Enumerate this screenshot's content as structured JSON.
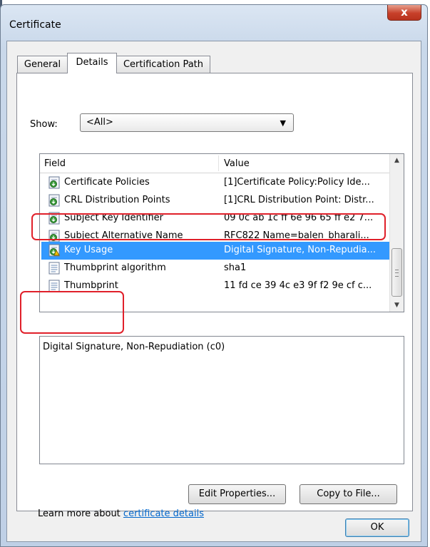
{
  "window": {
    "title": "Certificate",
    "close_symbol": "x"
  },
  "tabs": [
    {
      "label": "General",
      "active": false
    },
    {
      "label": "Details",
      "active": true
    },
    {
      "label": "Certification Path",
      "active": false
    }
  ],
  "show": {
    "label": "Show:",
    "selected": "<All>"
  },
  "table": {
    "headers": {
      "field": "Field",
      "value": "Value"
    },
    "rows": [
      {
        "field": "Certificate Policies",
        "value": "[1]Certificate Policy:Policy Ide...",
        "icon": "certificate-extension-icon"
      },
      {
        "field": "CRL Distribution Points",
        "value": "[1]CRL Distribution Point: Distr...",
        "icon": "certificate-extension-icon"
      },
      {
        "field": "Subject Key Identifier",
        "value": "09 0c ab 1c ff 6e 96 65 ff e2 7...",
        "icon": "certificate-extension-icon"
      },
      {
        "field": "Subject Alternative Name",
        "value": "RFC822 Name=balen_bharali...",
        "icon": "certificate-extension-icon"
      },
      {
        "field": "Key Usage",
        "value": "Digital Signature, Non-Repudia...",
        "icon": "certificate-critical-extension-icon",
        "selected": true
      },
      {
        "field": "Thumbprint algorithm",
        "value": "sha1",
        "icon": "document-property-icon"
      },
      {
        "field": "Thumbprint",
        "value": "11 fd ce 39 4c e3 9f f2 9e cf c...",
        "icon": "document-property-icon"
      }
    ]
  },
  "detail": {
    "text": "Digital Signature, Non-Repudiation (c0)"
  },
  "buttons": {
    "edit_properties": "Edit Properties...",
    "copy_to_file": "Copy to File...",
    "ok": "OK"
  },
  "learn_more": {
    "prefix": "Learn more about ",
    "link": "certificate details"
  },
  "colors": {
    "selection": "#3399ff",
    "annotation": "#e0202a",
    "link": "#0066cc"
  }
}
